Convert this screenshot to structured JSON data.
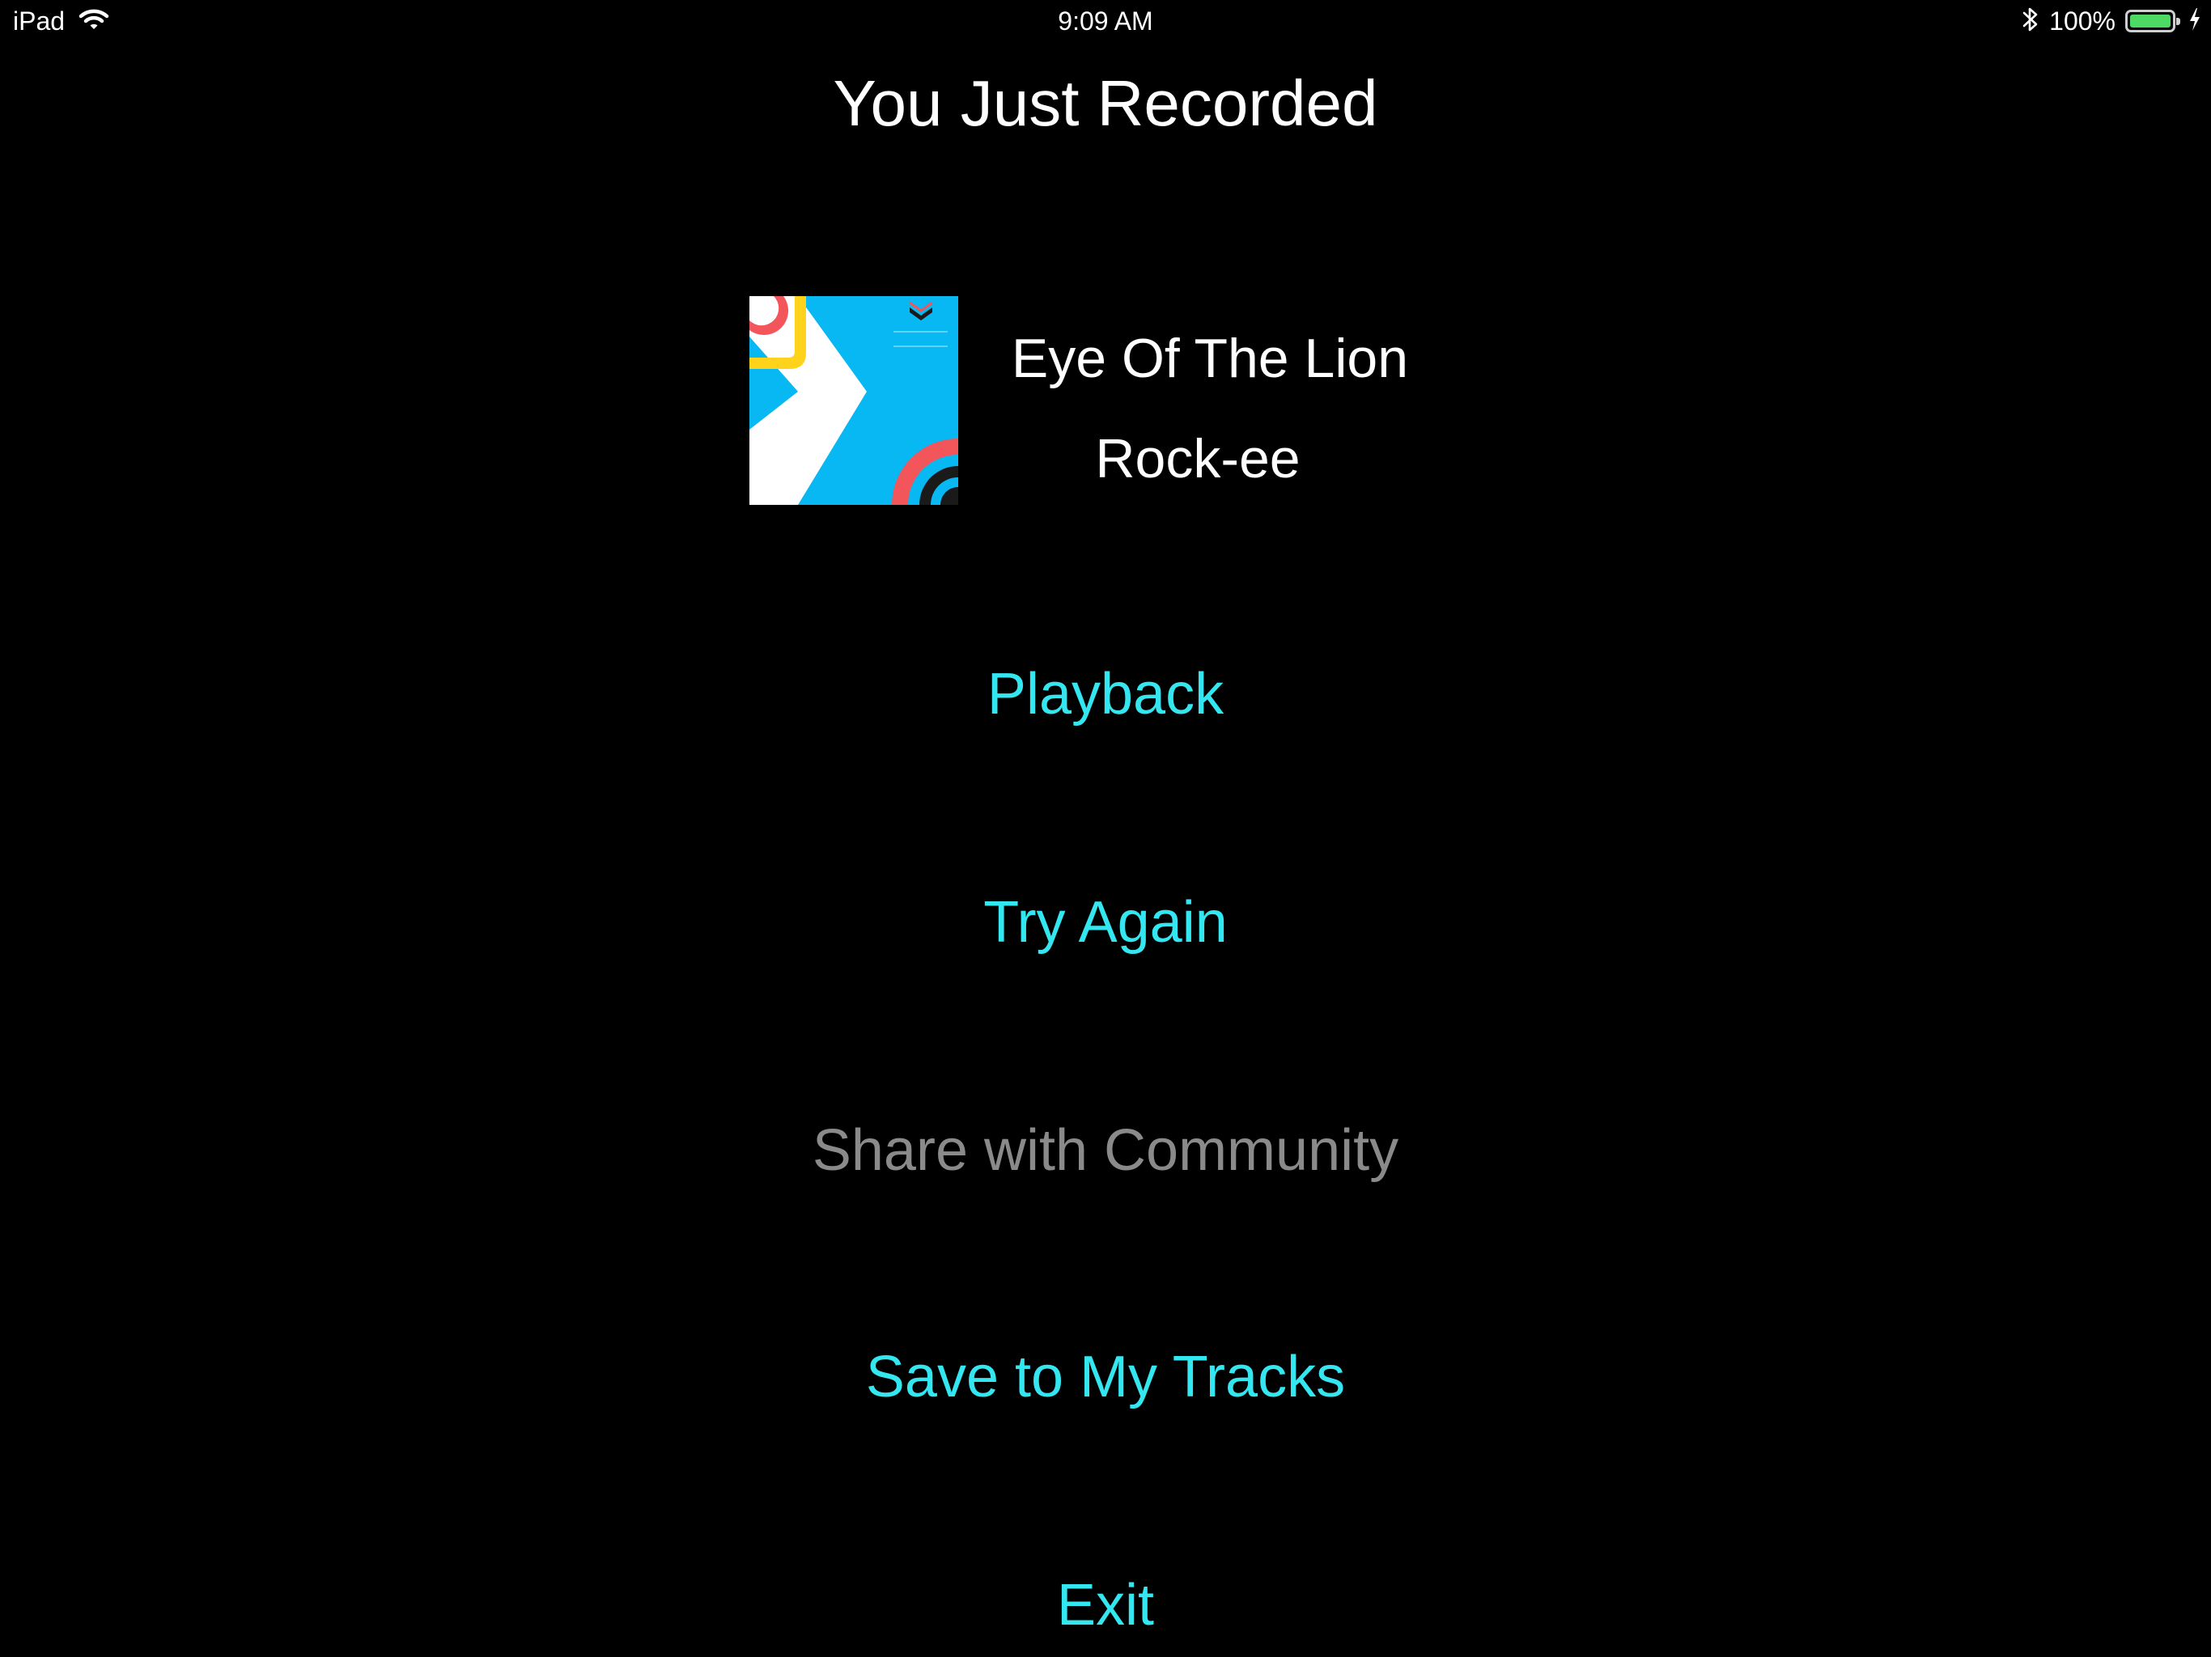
{
  "status_bar": {
    "device": "iPad",
    "time": "9:09 AM",
    "battery_percent_label": "100%",
    "battery_level": 1.0,
    "battery_color": "#4cd964"
  },
  "screen": {
    "title": "You Just Recorded"
  },
  "track": {
    "title": "Eye Of The Lion",
    "artist": "Rock-ee"
  },
  "actions": {
    "playback": "Playback",
    "try_again": "Try Again",
    "share": "Share with Community",
    "save": "Save to My Tracks",
    "exit": "Exit"
  },
  "colors": {
    "background": "#000000",
    "accent": "#33e6f0",
    "disabled": "#8a8a8a",
    "art_background": "#08b8f3",
    "art_yellow": "#ffd21c",
    "art_red": "#f2555a"
  },
  "icons": {
    "wifi": "wifi-icon",
    "bluetooth": "bluetooth-icon",
    "charging": "charging-bolt-icon",
    "battery": "battery-icon"
  }
}
